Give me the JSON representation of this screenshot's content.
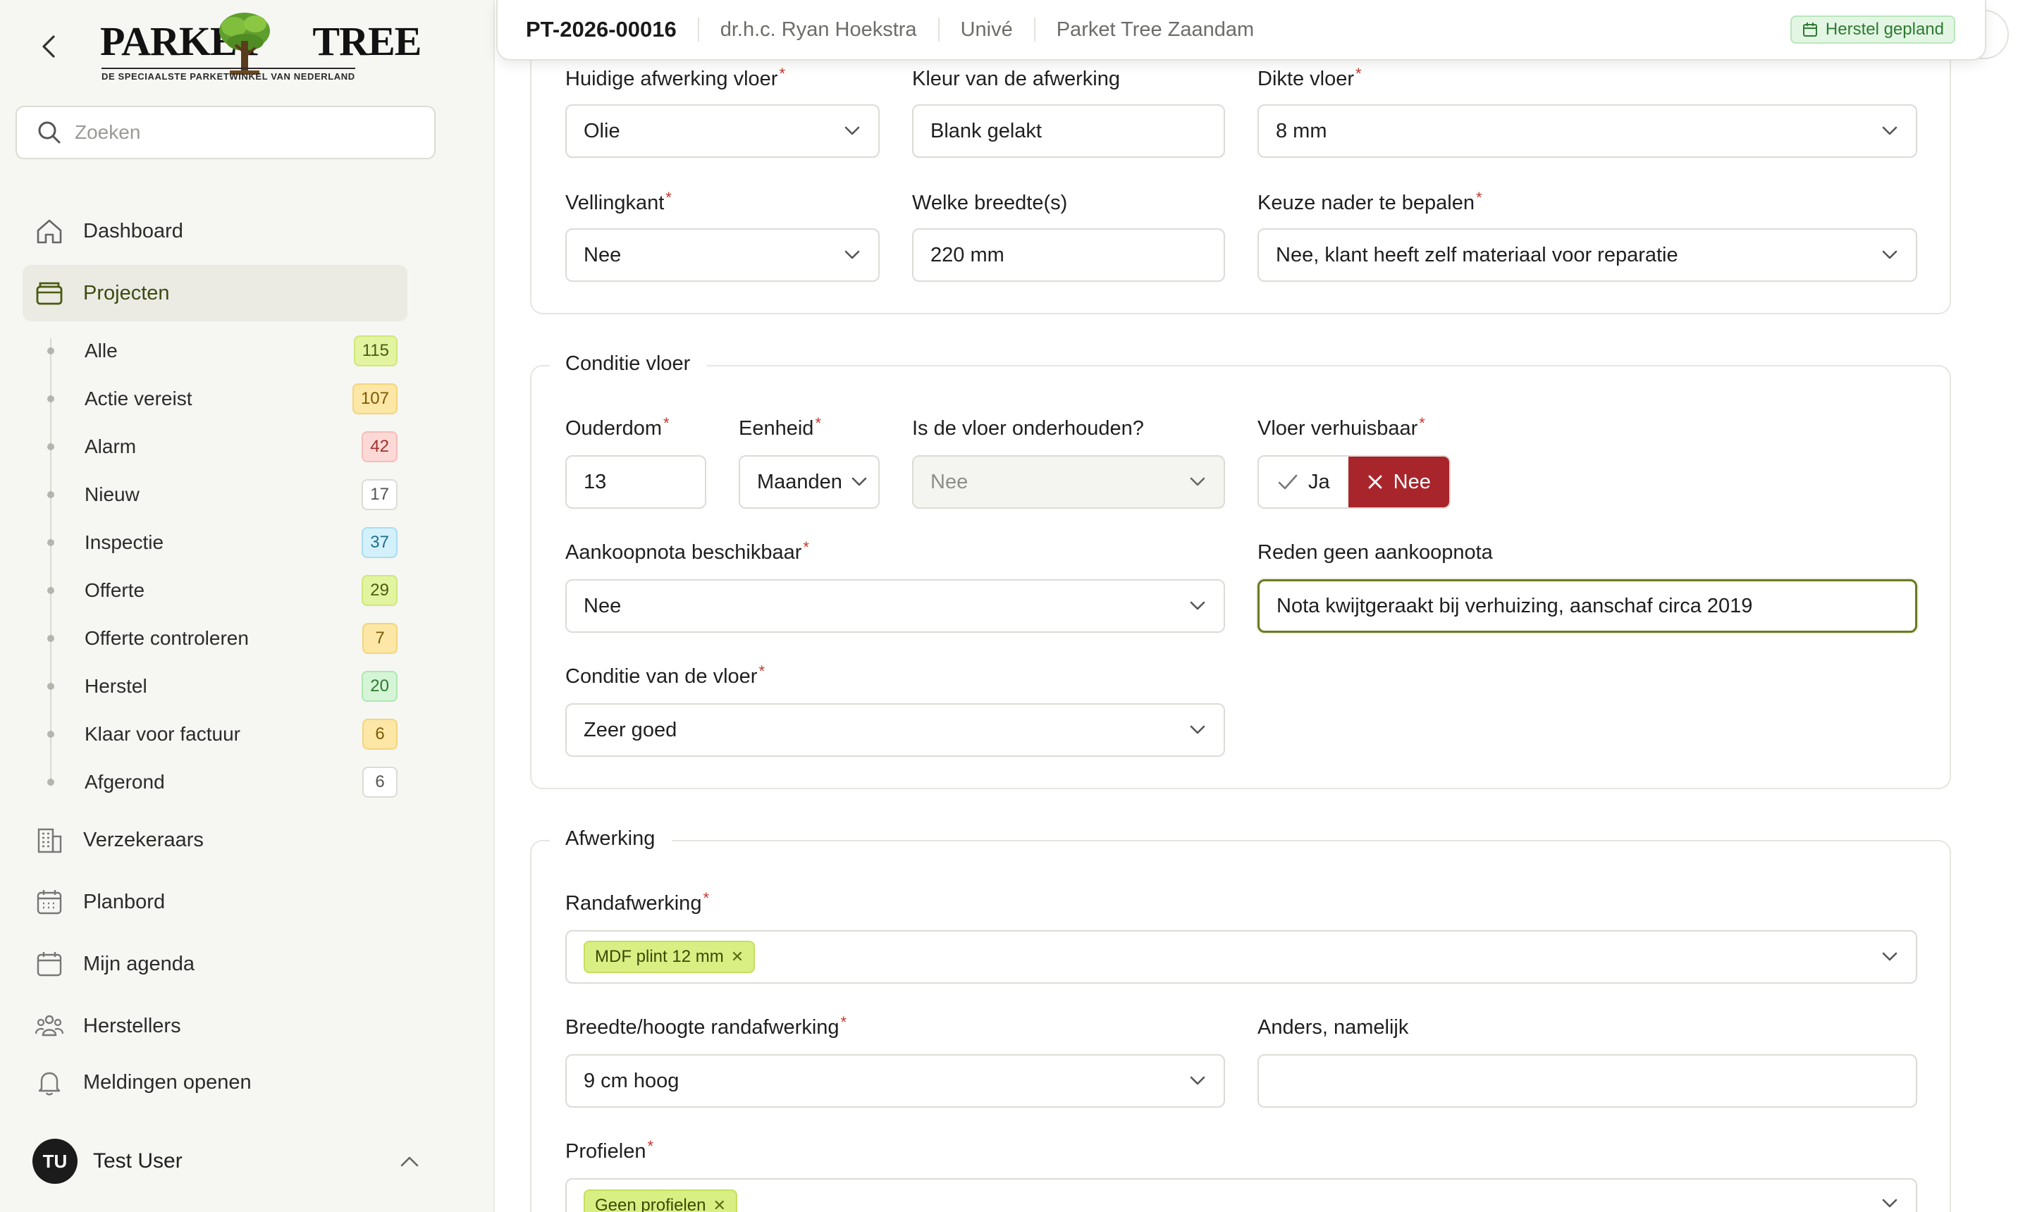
{
  "sidebar": {
    "back_icon": "chevron-left-icon",
    "logo": {
      "left": "PARKET",
      "right": "TREE",
      "tagline": "DE SPECIAALSTE PARKETWINKEL VAN NEDERLAND"
    },
    "search_placeholder": "Zoeken",
    "nav": [
      {
        "label": "Dashboard",
        "icon": "home-icon"
      },
      {
        "label": "Projecten",
        "icon": "folder-icon",
        "active": true
      },
      {
        "label": "Verzekeraars",
        "icon": "building-icon"
      },
      {
        "label": "Planbord",
        "icon": "calendar-grid-icon"
      },
      {
        "label": "Mijn agenda",
        "icon": "calendar-icon"
      },
      {
        "label": "Herstellers",
        "icon": "users-icon"
      },
      {
        "label": "Meldingen openen",
        "icon": "bell-icon"
      }
    ],
    "sub": [
      {
        "label": "Alle",
        "count": "115",
        "bg": "#e3f4a0",
        "border": "#cfe77a",
        "fg": "#4a5a10"
      },
      {
        "label": "Actie vereist",
        "count": "107",
        "bg": "#fde7a6",
        "border": "#f3d57a",
        "fg": "#7a5a08"
      },
      {
        "label": "Alarm",
        "count": "42",
        "bg": "#fcd9d6",
        "border": "#f5bdb8",
        "fg": "#a2322b"
      },
      {
        "label": "Nieuw",
        "count": "17",
        "bg": "#ffffff",
        "border": "#dcdcd6",
        "fg": "#555550"
      },
      {
        "label": "Inspectie",
        "count": "37",
        "bg": "#d3f0fb",
        "border": "#a8def2",
        "fg": "#1f6f8b"
      },
      {
        "label": "Offerte",
        "count": "29",
        "bg": "#e3f4a0",
        "border": "#cfe77a",
        "fg": "#4a5a10"
      },
      {
        "label": "Offerte controleren",
        "count": "7",
        "bg": "#fde7a6",
        "border": "#f3d57a",
        "fg": "#7a5a08"
      },
      {
        "label": "Herstel",
        "count": "20",
        "bg": "#d5f5d6",
        "border": "#ade8b0",
        "fg": "#2b7a31"
      },
      {
        "label": "Klaar voor factuur",
        "count": "6",
        "bg": "#fde7a6",
        "border": "#f3d57a",
        "fg": "#7a5a08"
      },
      {
        "label": "Afgerond",
        "count": "6",
        "bg": "#ffffff",
        "border": "#dcdcd6",
        "fg": "#555550"
      }
    ],
    "user": {
      "initials": "TU",
      "name": "Test User"
    }
  },
  "topbar": {
    "project_id": "PT-2026-00016",
    "client": "dr.h.c. Ryan Hoekstra",
    "insurer": "Univé",
    "branch": "Parket Tree Zaandam",
    "status": "Herstel gepland"
  },
  "floor": {
    "finish_label": "Huidige afwerking vloer",
    "finish_value": "Olie",
    "finish_color_label": "Kleur van de afwerking",
    "finish_color_value": "Blank gelakt",
    "thickness_label": "Dikte vloer",
    "thickness_value": "8 mm",
    "bevel_label": "Vellingkant",
    "bevel_value": "Nee",
    "widths_label": "Welke breedte(s)",
    "widths_value": "220 mm",
    "choice_label": "Keuze nader te bepalen",
    "choice_value": "Nee, klant heeft zelf materiaal voor reparatie"
  },
  "condition": {
    "legend": "Conditie vloer",
    "age_label": "Ouderdom",
    "age_value": "13",
    "unit_label": "Eenheid",
    "unit_value": "Maanden",
    "maintained_label": "Is de vloer onderhouden?",
    "maintained_value": "Nee",
    "movable_label": "Vloer verhuisbaar",
    "movable_yes": "Ja",
    "movable_no": "Nee",
    "receipt_label": "Aankoopnota beschikbaar",
    "receipt_value": "Nee",
    "reason_label": "Reden geen aankoopnota",
    "reason_value": "Nota kwijtgeraakt bij verhuizing, aanschaf circa 2019",
    "state_label": "Conditie van de vloer",
    "state_value": "Zeer goed"
  },
  "finishing": {
    "legend": "Afwerking",
    "edge_label": "Randafwerking",
    "edge_tag": "MDF plint 12 mm",
    "edge_size_label": "Breedte/hoogte randafwerking",
    "edge_size_value": "9 cm hoog",
    "other_label": "Anders, namelijk",
    "other_value": "",
    "profiles_label": "Profielen",
    "profiles_tag": "Geen profielen"
  }
}
